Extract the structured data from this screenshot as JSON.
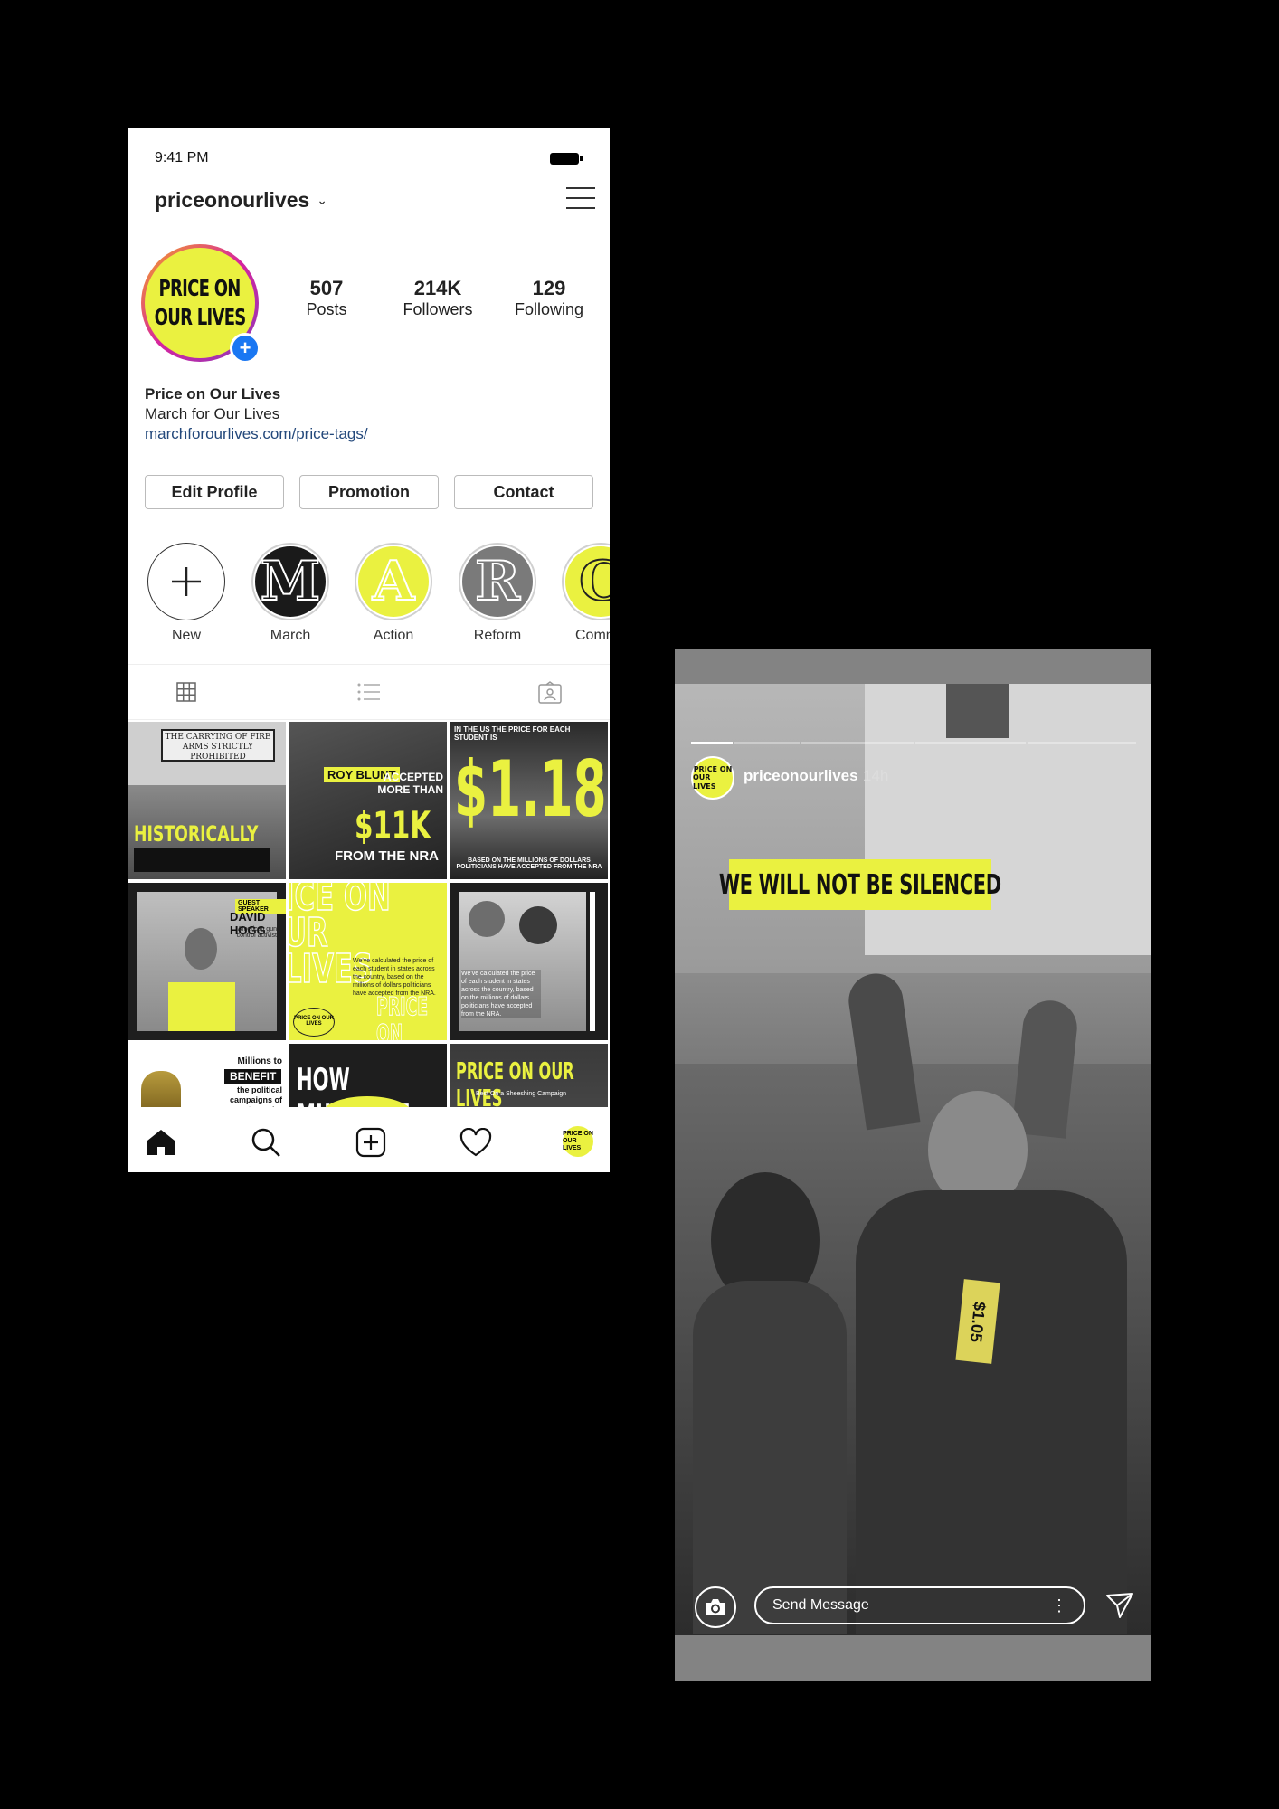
{
  "profile": {
    "status": {
      "time": "9:41 PM"
    },
    "username": "priceonourlives",
    "avatar_text": [
      "PRICE ON",
      "OUR LIVES"
    ],
    "stats": [
      {
        "value": "507",
        "label": "Posts"
      },
      {
        "value": "214K",
        "label": "Followers"
      },
      {
        "value": "129",
        "label": "Following"
      }
    ],
    "bio": {
      "name": "Price on Our Lives",
      "subtitle": "March for Our Lives",
      "link": "marchforourlives.com/price-tags/"
    },
    "buttons": {
      "edit": "Edit Profile",
      "promotion": "Promotion",
      "contact": "Contact"
    },
    "highlights": [
      {
        "letter": "+",
        "label": "New"
      },
      {
        "letter": "M",
        "label": "March"
      },
      {
        "letter": "A",
        "label": "Action"
      },
      {
        "letter": "R",
        "label": "Reform"
      },
      {
        "letter": "C",
        "label": "Commu"
      }
    ],
    "grid": {
      "tile1_sign": "THE CARRYING OF FIRE ARMS STRICTLY PROHIBITED",
      "tile1_title": "HISTORICALLY",
      "tile2_name": "ROY BLUNT",
      "tile2_text1": "ACCEPTED MORE THAN",
      "tile2_amount": "$11K",
      "tile2_text2": "FROM THE NRA",
      "tile3_top": "IN THE US THE PRICE FOR EACH STUDENT IS",
      "tile3_amount": "$1.18",
      "tile3_bottom": "BASED ON THE MILLIONS OF DOLLARS POLITICIANS HAVE ACCEPTED FROM THE NRA",
      "tile4_tag": "GUEST SPEAKER",
      "tile4_name": "DAVID HOGG",
      "tile4_role": "American gun control activist",
      "tile5_title": "ICE ON UR LIVES",
      "tile5_body": "We've calculated the price of each student in states across the country, based on the millions of dollars politicians have accepted from the NRA.",
      "tile5_logo": "PRICE ON OUR LIVES",
      "tile5_footer": "PRICE ON OUR LIVE",
      "tile6_body": "We've calculated the price of each student in states across the country, based on the millions of dollars politicians have accepted from the NRA.",
      "tile7_text1": "Millions to",
      "tile7_tag": "BENEFIT",
      "tile7_text2": "the political campaigns of senators who",
      "tile8_title": "HOW MUCH ARE",
      "tile9_title": "PRICE ON OUR LIVES",
      "tile9_sub": "Best On a Sheeshing Campaign"
    },
    "nav_avatar_text": [
      "PRICE ON",
      "OUR LIVES"
    ]
  },
  "story": {
    "avatar_text": [
      "PRICE ON",
      "OUR LIVES"
    ],
    "username": "priceonourlives",
    "time": "14h",
    "banner": "WE WILL NOT BE SILENCED",
    "send_placeholder": "Send Message",
    "price_tag": "$1.05"
  },
  "colors": {
    "brand_yellow": "#eaf140",
    "link_blue": "#23487b",
    "badge_blue": "#1a77f2"
  },
  "icons": [
    "hamburger-icon",
    "plus-icon",
    "grid-icon",
    "list-icon",
    "tagged-icon",
    "home-icon",
    "search-icon",
    "add-post-icon",
    "heart-icon",
    "camera-icon",
    "send-icon",
    "more-icon"
  ]
}
